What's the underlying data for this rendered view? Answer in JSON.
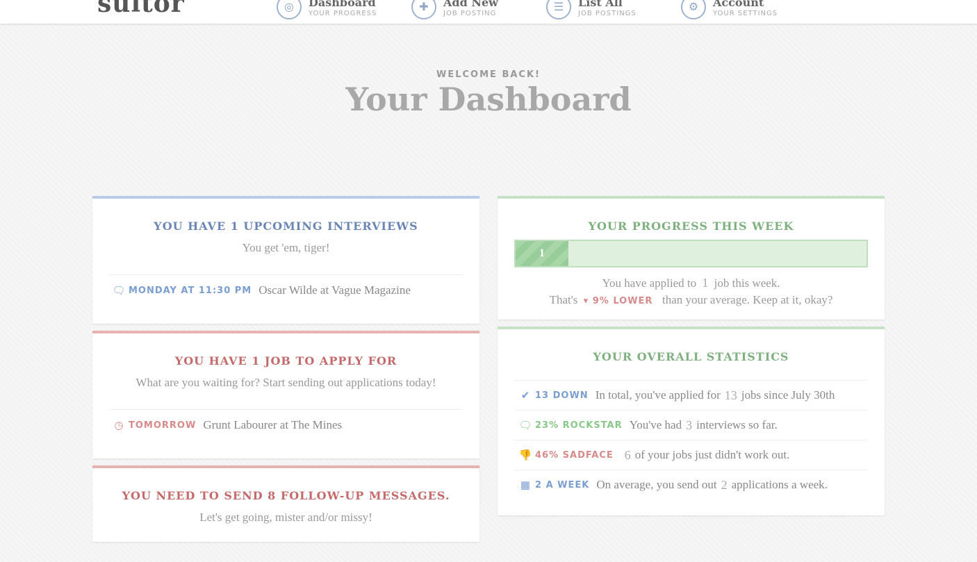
{
  "app": {
    "logo": "suitor"
  },
  "nav": [
    {
      "title": "Dashboard",
      "subtitle": "YOUR PROGRESS",
      "icon": "dashboard-icon"
    },
    {
      "title": "Add New",
      "subtitle": "JOB POSTING",
      "icon": "plus-icon"
    },
    {
      "title": "List All",
      "subtitle": "JOB POSTINGS",
      "icon": "list-icon"
    },
    {
      "title": "Account",
      "subtitle": "YOUR SETTINGS",
      "icon": "settings-icon"
    }
  ],
  "header": {
    "welcome": "WELCOME BACK!",
    "title": "Your Dashboard"
  },
  "interviews": {
    "heading": "YOU HAVE 1 UPCOMING INTERVIEWS",
    "subtitle": "You get 'em, tiger!",
    "item": {
      "when": "MONDAY AT 11:30 PM",
      "text": "Oscar Wilde at Vague Magazine",
      "icon": "chat-icon"
    }
  },
  "apply": {
    "heading": "YOU HAVE 1 JOB TO APPLY FOR",
    "subtitle": "What are you waiting for? Start sending out applications today!",
    "item": {
      "when": "TOMORROW",
      "text": "Grunt Labourer at The Mines",
      "icon": "clock-icon"
    }
  },
  "followups": {
    "heading": "YOU NEED TO SEND 8 FOLLOW-UP MESSAGES.",
    "subtitle": "Let's get going, mister and/or missy!"
  },
  "progress": {
    "heading": "YOUR PROGRESS THIS WEEK",
    "bar_label": "1",
    "bar_fill_fraction": 0.15,
    "line1_a": "You have applied to",
    "line1_num": "1",
    "line1_b": "job this week.",
    "line2_a": "That's",
    "line2_tag": "9% LOWER",
    "line2_b": "than your average. Keep at it, okay?"
  },
  "stats": {
    "heading": "YOUR OVERALL STATISTICS",
    "rows": [
      {
        "icon": "check-icon",
        "tag": "13 DOWN",
        "a": "In total, you've applied for",
        "num": "13",
        "b": "jobs since July 30th",
        "color": "blue"
      },
      {
        "icon": "chat-icon",
        "tag": "23% ROCKSTAR",
        "a": "You've had",
        "num": "3",
        "b": "interviews so far.",
        "color": "green"
      },
      {
        "icon": "thumbs-down-icon",
        "tag": "46% SADFACE",
        "a": "",
        "num": "6",
        "b": "of your jobs just didn't work out.",
        "color": "red"
      },
      {
        "icon": "calendar-icon",
        "tag": "2 A WEEK",
        "a": "On average, you send out",
        "num": "2",
        "b": "applications a week.",
        "color": "blue"
      }
    ]
  }
}
